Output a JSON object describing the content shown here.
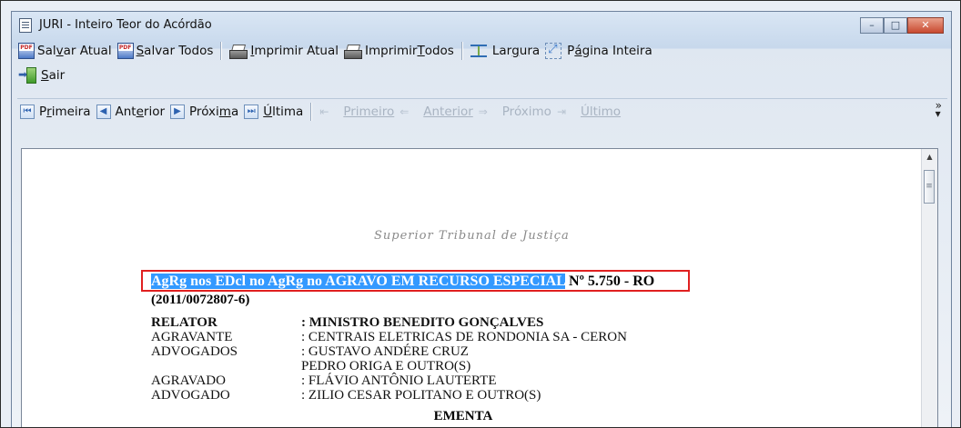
{
  "window": {
    "title": "JURI - Inteiro Teor do Acórdão",
    "controls": {
      "minimize": "–",
      "maximize": "□",
      "close": "✕"
    }
  },
  "toolbar1": {
    "salvar_atual_pre": "Sal",
    "salvar_atual_ul": "v",
    "salvar_atual_post": "ar Atual",
    "salvar_todos_ul": "S",
    "salvar_todos_post": "alvar Todos",
    "imprimir_atual_ul": "I",
    "imprimir_atual_post": "mprimir Atual",
    "imprimir_todos_pre": "Imprimir ",
    "imprimir_todos_ul": "T",
    "imprimir_todos_post": "odos",
    "largura_pre": "Lar",
    "largura_ul": "g",
    "largura_post": "ura",
    "pagina_pre": "P",
    "pagina_ul": "á",
    "pagina_post": "gina Inteira"
  },
  "toolbar2": {
    "sair_ul": "S",
    "sair_post": "air"
  },
  "toolbar3": {
    "primeira_pre": "P",
    "primeira_ul": "r",
    "primeira_post": "imeira",
    "anterior_pre": "Ant",
    "anterior_ul": "e",
    "anterior_post": "rior",
    "proxima_pre": "Próxi",
    "proxima_ul": "m",
    "proxima_post": "a",
    "ultima_ul": "Ú",
    "ultima_post": "ltima",
    "primeiro_label": "Primeiro",
    "anterior2_label": "Anterior",
    "proximo_label": "Próximo",
    "ultimo_label": "Último",
    "overflow": "»"
  },
  "document": {
    "court_header": "Superior Tribunal de Justiça",
    "process_highlight": "AgRg nos EDcl no AgRg no AGRAVO EM RECURSO ESPECIAL",
    "process_number": " Nº 5.750 - RO",
    "registro": "(2011/0072807-6)",
    "parties": [
      {
        "role": "RELATOR",
        "value": ": MINISTRO BENEDITO GONÇALVES",
        "bold": true
      },
      {
        "role": "AGRAVANTE",
        "value": ": CENTRAIS ELETRICAS DE RONDONIA SA - CERON",
        "bold": false
      },
      {
        "role": "ADVOGADOS",
        "value": ": GUSTAVO ANDÉRE CRUZ",
        "bold": false
      },
      {
        "role": "",
        "value": "  PEDRO ORIGA E OUTRO(S)",
        "bold": false
      },
      {
        "role": "AGRAVADO",
        "value": ": FLÁVIO ANTÔNIO LAUTERTE",
        "bold": false
      },
      {
        "role": "ADVOGADO",
        "value": ": ZILIO CESAR POLITANO E OUTRO(S)",
        "bold": false
      }
    ],
    "ementa": "EMENTA"
  },
  "colors": {
    "highlight": "#3399ff",
    "annotation_box": "#e02020"
  }
}
